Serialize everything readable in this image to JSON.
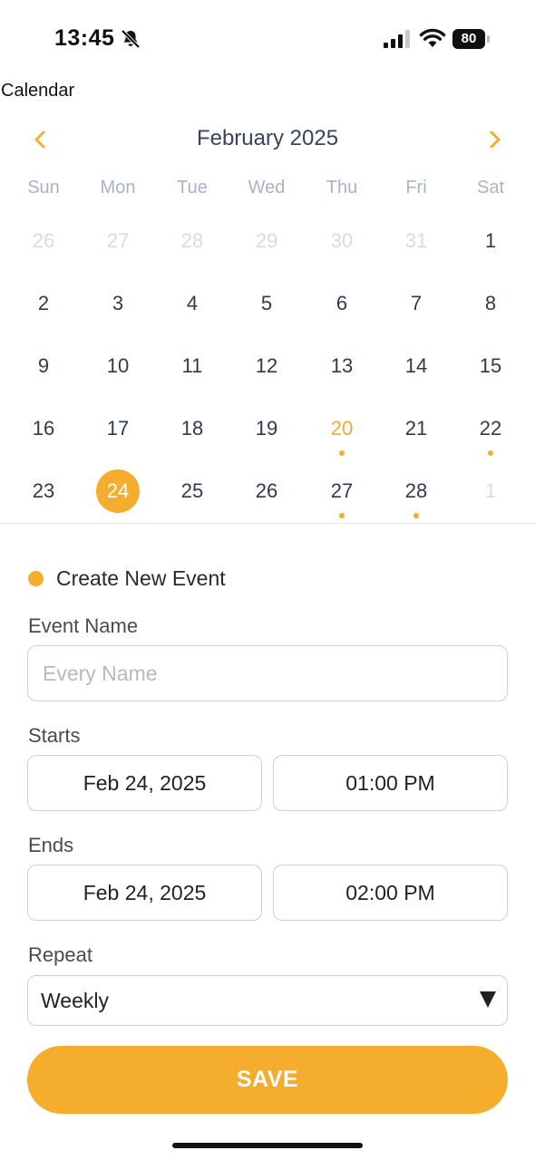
{
  "status_bar": {
    "time": "13:45",
    "battery_level": "80",
    "icons": [
      "bell-slash-icon",
      "cellular-signal-icon",
      "wifi-icon",
      "battery-icon"
    ]
  },
  "app": {
    "title": "Calendar"
  },
  "calendar": {
    "month_title": "February 2025",
    "prev_icon": "chevron-left-icon",
    "next_icon": "chevron-right-icon",
    "accent_color": "#f4ad2c",
    "weekdays": [
      "Sun",
      "Mon",
      "Tue",
      "Wed",
      "Thu",
      "Fri",
      "Sat"
    ],
    "weeks": [
      [
        {
          "day": "26",
          "muted": true
        },
        {
          "day": "27",
          "muted": true
        },
        {
          "day": "28",
          "muted": true
        },
        {
          "day": "29",
          "muted": true
        },
        {
          "day": "30",
          "muted": true
        },
        {
          "day": "31",
          "muted": true
        },
        {
          "day": "1"
        }
      ],
      [
        {
          "day": "2"
        },
        {
          "day": "3"
        },
        {
          "day": "4"
        },
        {
          "day": "5"
        },
        {
          "day": "6"
        },
        {
          "day": "7"
        },
        {
          "day": "8"
        }
      ],
      [
        {
          "day": "9"
        },
        {
          "day": "10"
        },
        {
          "day": "11"
        },
        {
          "day": "12"
        },
        {
          "day": "13"
        },
        {
          "day": "14"
        },
        {
          "day": "15"
        }
      ],
      [
        {
          "day": "16"
        },
        {
          "day": "17"
        },
        {
          "day": "18"
        },
        {
          "day": "19"
        },
        {
          "day": "20",
          "today": true,
          "event": true
        },
        {
          "day": "21"
        },
        {
          "day": "22",
          "event": true
        }
      ],
      [
        {
          "day": "23"
        },
        {
          "day": "24",
          "selected": true
        },
        {
          "day": "25"
        },
        {
          "day": "26"
        },
        {
          "day": "27",
          "event": true
        },
        {
          "day": "28",
          "event": true
        },
        {
          "day": "1",
          "muted": true
        }
      ]
    ]
  },
  "form": {
    "section_title": "Create New Event",
    "event_name_label": "Event Name",
    "event_name_value": "",
    "event_name_placeholder": "Every Name",
    "starts_label": "Starts",
    "start_date": "Feb 24, 2025",
    "start_time": "01:00 PM",
    "ends_label": "Ends",
    "end_date": "Feb 24, 2025",
    "end_time": "02:00 PM",
    "repeat_label": "Repeat",
    "repeat_value": "Weekly",
    "save_label": "SAVE"
  }
}
